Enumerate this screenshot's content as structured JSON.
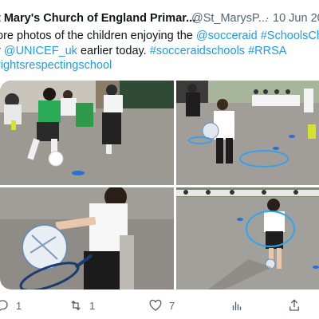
{
  "tweet": {
    "author_name": "t Mary's Church of England Primar...",
    "author_handle": "@St_MarysP...",
    "separator": "·",
    "date": "10 Jun 20",
    "lines": [
      {
        "a": "ore photos of the children enjoying the ",
        "b": "@socceraid #SchoolsCh"
      },
      {
        "a": "r ",
        "b": "@UNICEF_uk",
        "c": " earlier today. ",
        "d": "#socceraidschools #RRSA"
      },
      {
        "a": "",
        "b": "rightsrespectingschool"
      }
    ],
    "media": {
      "photos": [
        {
          "name": "photo-girl-dribbling-ball"
        },
        {
          "name": "photo-boy-with-ball-and-hoop"
        },
        {
          "name": "photo-girl-holding-racket-and-ball"
        },
        {
          "name": "photo-girl-with-hoop"
        }
      ]
    },
    "actions": {
      "reply": {
        "icon": "reply-icon",
        "count": "1"
      },
      "retweet": {
        "icon": "retweet-icon",
        "count": "1"
      },
      "like": {
        "icon": "heart-icon",
        "count": "7"
      },
      "views": {
        "icon": "views-icon",
        "count": ""
      },
      "share": {
        "icon": "share-icon",
        "count": ""
      }
    }
  },
  "colors": {
    "link": "#1d9bf0",
    "text": "#0f1419",
    "secondary": "#536471"
  }
}
